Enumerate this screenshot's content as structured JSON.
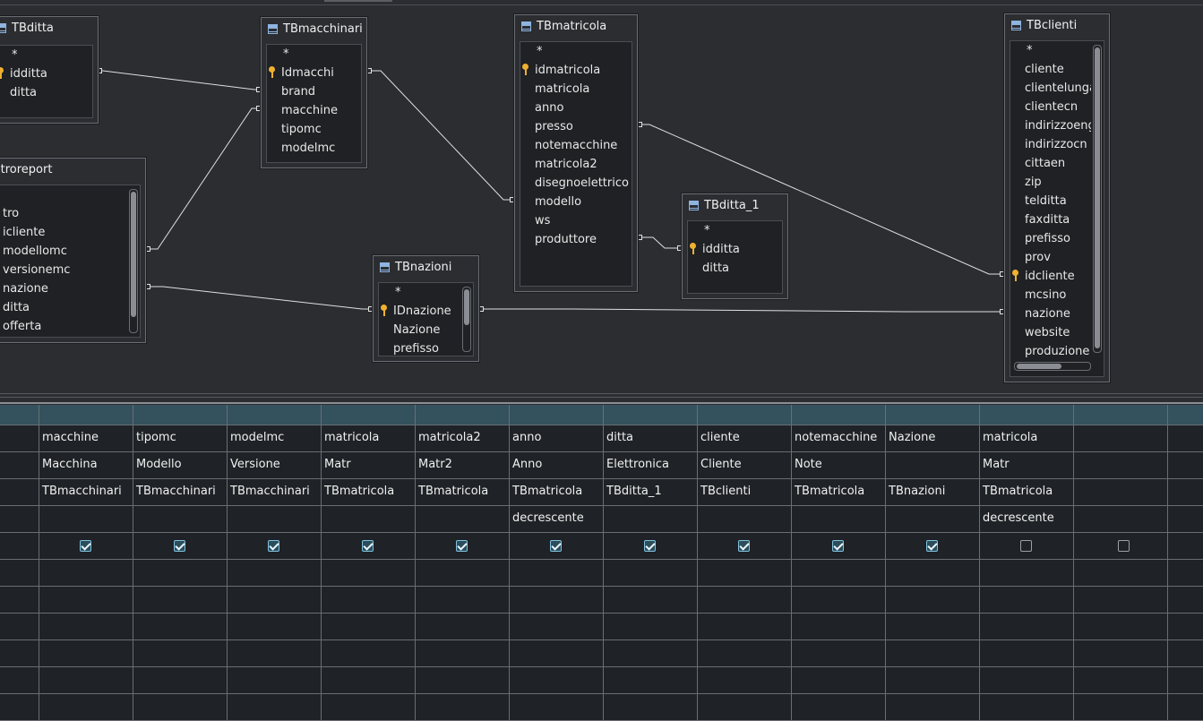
{
  "design_view": {
    "tables": {
      "TBditta": {
        "title": "TBditta",
        "fields": [
          "*",
          "idditta",
          "ditta"
        ]
      },
      "TBmacchinari": {
        "title": "TBmacchinari",
        "fields": [
          "*",
          "Idmacchi",
          "brand",
          "macchine",
          "tipomc",
          "modelmc"
        ]
      },
      "TBmatricola": {
        "title": "TBmatricola",
        "fields": [
          "*",
          "idmatricola",
          "matricola",
          "anno",
          "presso",
          "notemacchine",
          "matricola2",
          "disegnoelettrico",
          "modello",
          "ws",
          "produttore"
        ]
      },
      "TBclienti": {
        "title": "TBclienti",
        "fields": [
          "*",
          "cliente",
          "clientelunga",
          "clientecn",
          "indirizzoeng",
          "indirizzocn",
          "cittaen",
          "zip",
          "telditta",
          "faxditta",
          "prefisso",
          "prov",
          "idcliente",
          "mcsino",
          "nazione",
          "website",
          "produzione"
        ]
      },
      "filtroreport": {
        "title": "ltroreport",
        "fields": [
          "",
          "tro",
          "icliente",
          "modellomc",
          "versionemc",
          "nazione",
          "ditta",
          "offerta"
        ]
      },
      "TBditta_1": {
        "title": "TBditta_1",
        "fields": [
          "*",
          "idditta",
          "ditta"
        ]
      },
      "TBnazioni": {
        "title": "TBnazioni",
        "fields": [
          "*",
          "IDnazione",
          "Nazione",
          "prefisso"
        ]
      }
    }
  },
  "query_grid": {
    "columns": [
      {
        "field": "macchine",
        "alias": "Macchina",
        "table": "TBmacchinari",
        "sort": "",
        "visible": true
      },
      {
        "field": "tipomc",
        "alias": "Modello",
        "table": "TBmacchinari",
        "sort": "",
        "visible": true
      },
      {
        "field": "modelmc",
        "alias": "Versione",
        "table": "TBmacchinari",
        "sort": "",
        "visible": true
      },
      {
        "field": "matricola",
        "alias": "Matr",
        "table": "TBmatricola",
        "sort": "",
        "visible": true
      },
      {
        "field": "matricola2",
        "alias": "Matr2",
        "table": "TBmatricola",
        "sort": "",
        "visible": true
      },
      {
        "field": "anno",
        "alias": "Anno",
        "table": "TBmatricola",
        "sort": "decrescente",
        "visible": true
      },
      {
        "field": "ditta",
        "alias": "Elettronica",
        "table": "TBditta_1",
        "sort": "",
        "visible": true
      },
      {
        "field": "cliente",
        "alias": "Cliente",
        "table": "TBclienti",
        "sort": "",
        "visible": true
      },
      {
        "field": "notemacchine",
        "alias": "Note",
        "table": "TBmatricola",
        "sort": "",
        "visible": true
      },
      {
        "field": "Nazione",
        "alias": "",
        "table": "TBnazioni",
        "sort": "",
        "visible": true
      },
      {
        "field": "matricola",
        "alias": "Matr",
        "table": "TBmatricola",
        "sort": "decrescente",
        "visible": false
      },
      {
        "field": "",
        "alias": "",
        "table": "",
        "sort": "",
        "visible": false
      }
    ]
  }
}
